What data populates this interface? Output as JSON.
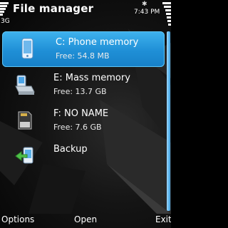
{
  "status": {
    "network": "3G",
    "time": "7:43 PM",
    "bluetooth_icon": "bluetooth-icon",
    "signal_level": 1.0,
    "battery_level": 1.0
  },
  "app": {
    "title": "File manager"
  },
  "memories": [
    {
      "icon": "phone-memory-icon",
      "title": "C: Phone memory",
      "subtitle": "Free: 54.8 MB",
      "selected": true
    },
    {
      "icon": "mass-memory-icon",
      "title": "E: Mass memory",
      "subtitle": "Free: 13.7 GB",
      "selected": false
    },
    {
      "icon": "memory-card-icon",
      "title": "F: NO NAME",
      "subtitle": "Free: 7.6 GB",
      "selected": false
    },
    {
      "icon": "backup-icon",
      "title": "Backup",
      "subtitle": "",
      "selected": false
    }
  ],
  "softkeys": {
    "left": "Options",
    "middle": "Open",
    "right": "Exit"
  },
  "colors": {
    "highlight": "#1f8fd6",
    "background": "#0a0a0a"
  }
}
